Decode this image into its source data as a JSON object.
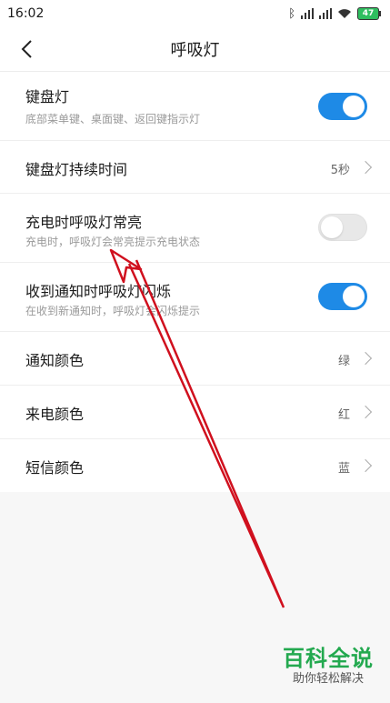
{
  "status": {
    "time": "16:02",
    "battery": "47"
  },
  "header": {
    "title": "呼吸灯"
  },
  "rows": [
    {
      "title": "键盘灯",
      "subtitle": "底部菜单键、桌面键、返回键指示灯",
      "toggle_on": true
    },
    {
      "title": "键盘灯持续时间",
      "value": "5秒"
    },
    {
      "title": "充电时呼吸灯常亮",
      "subtitle": "充电时，呼吸灯会常亮提示充电状态",
      "toggle_on": false
    },
    {
      "title": "收到通知时呼吸灯闪烁",
      "subtitle": "在收到新通知时，呼吸灯会闪烁提示",
      "toggle_on": true
    },
    {
      "title": "通知颜色",
      "value": "绿"
    },
    {
      "title": "来电颜色",
      "value": "红"
    },
    {
      "title": "短信颜色",
      "value": "蓝"
    }
  ],
  "watermark": {
    "title": "百科全说",
    "subtitle": "助你轻松解决"
  },
  "colors": {
    "accent": "#1e8ae6",
    "annotation": "#d0101e",
    "watermark": "#23a94f"
  }
}
